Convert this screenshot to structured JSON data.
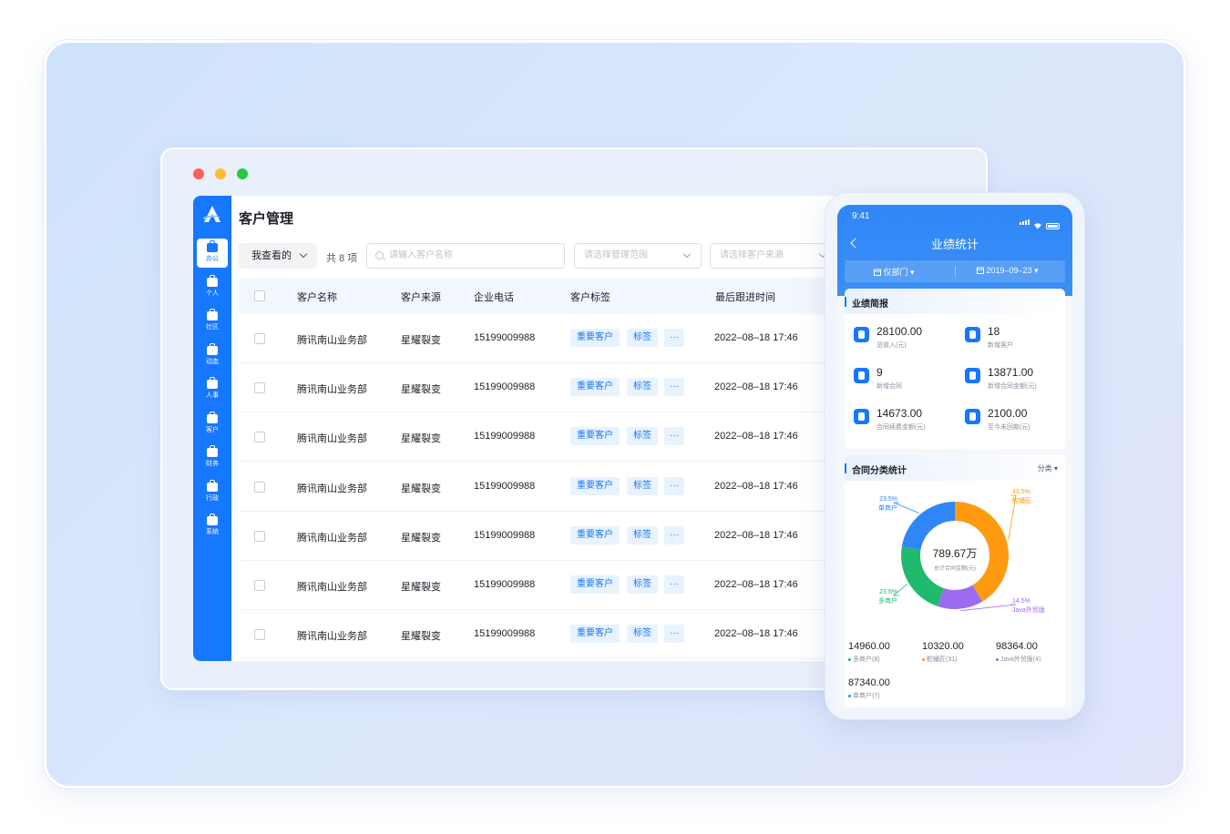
{
  "desktop": {
    "window_dots": [
      "#ff5f57",
      "#febc2e",
      "#28c840"
    ],
    "page_title": "客户管理",
    "sidebar": {
      "logo": "app-logo",
      "items": [
        {
          "label": "办公",
          "icon": "briefcase-icon",
          "active": true
        },
        {
          "label": "个人",
          "icon": "briefcase-icon"
        },
        {
          "label": "社区",
          "icon": "briefcase-icon"
        },
        {
          "label": "动态",
          "icon": "briefcase-icon"
        },
        {
          "label": "人事",
          "icon": "briefcase-icon"
        },
        {
          "label": "客户",
          "icon": "briefcase-icon"
        },
        {
          "label": "财务",
          "icon": "briefcase-icon"
        },
        {
          "label": "行政",
          "icon": "briefcase-icon"
        },
        {
          "label": "系统",
          "icon": "briefcase-icon"
        }
      ]
    },
    "toolbar": {
      "view_filter": "我查看的",
      "count": "共 8 项",
      "search_placeholder": "请输入客户名称",
      "scope_placeholder": "请选择管理范围",
      "source_placeholder": "请选择客户来源"
    },
    "table": {
      "columns": [
        "客户名称",
        "客户来源",
        "企业电话",
        "客户标签",
        "最后跟进时间"
      ],
      "rows": [
        {
          "name": "腾讯南山业务部",
          "source": "星耀裂变",
          "phone": "15199009988",
          "tags": [
            "重要客户",
            "标签",
            "···"
          ],
          "last": "2022–08–18 17:46"
        },
        {
          "name": "腾讯南山业务部",
          "source": "星耀裂变",
          "phone": "15199009988",
          "tags": [
            "重要客户",
            "标签",
            "···"
          ],
          "last": "2022–08–18 17:46"
        },
        {
          "name": "腾讯南山业务部",
          "source": "星耀裂变",
          "phone": "15199009988",
          "tags": [
            "重要客户",
            "标签",
            "···"
          ],
          "last": "2022–08–18 17:46"
        },
        {
          "name": "腾讯南山业务部",
          "source": "星耀裂变",
          "phone": "15199009988",
          "tags": [
            "重要客户",
            "标签",
            "···"
          ],
          "last": "2022–08–18 17:46"
        },
        {
          "name": "腾讯南山业务部",
          "source": "星耀裂变",
          "phone": "15199009988",
          "tags": [
            "重要客户",
            "标签",
            "···"
          ],
          "last": "2022–08–18 17:46"
        },
        {
          "name": "腾讯南山业务部",
          "source": "星耀裂变",
          "phone": "15199009988",
          "tags": [
            "重要客户",
            "标签",
            "···"
          ],
          "last": "2022–08–18 17:46"
        },
        {
          "name": "腾讯南山业务部",
          "source": "星耀裂变",
          "phone": "15199009988",
          "tags": [
            "重要客户",
            "标签",
            "···"
          ],
          "last": "2022–08–18 17:46"
        }
      ]
    }
  },
  "mobile": {
    "time": "9:41",
    "title": "业绩统计",
    "filters": {
      "dept": "仅部门",
      "date": "2019–09–23"
    },
    "report": {
      "title": "业绩简报",
      "kpis": [
        {
          "value": "28100.00",
          "label": "总收入(元)",
          "icon": "money-bag-icon"
        },
        {
          "value": "18",
          "label": "新增客户",
          "icon": "user-icon"
        },
        {
          "value": "9",
          "label": "新增合同",
          "icon": "contract-icon"
        },
        {
          "value": "13871.00",
          "label": "新增合同金额(元)",
          "icon": "yen-icon"
        },
        {
          "value": "14673.00",
          "label": "合同续费金额(元)",
          "icon": "coins-icon"
        },
        {
          "value": "2100.00",
          "label": "至今未回款(元)",
          "icon": "coins-icon"
        }
      ]
    },
    "contract_stats": {
      "title": "合同分类统计",
      "classify": "分类",
      "center_value": "789.67万",
      "center_label": "总计合同金额(元)",
      "summary": [
        {
          "value": "14960.00",
          "label": "多商户(8)",
          "color": "#1fba6e"
        },
        {
          "value": "10320.00",
          "label": "舵蛹匠(31)",
          "color": "#ff9a10"
        },
        {
          "value": "98364.00",
          "label": "Java外贸版(4)",
          "color": "#9b6bf2"
        },
        {
          "value": "87340.00",
          "label": "单商户(7)",
          "color": "#2f86f6"
        }
      ]
    }
  },
  "chart_data": {
    "type": "pie",
    "categories": [
      "舵蛹匠",
      "Java外贸版",
      "多商户",
      "单商户"
    ],
    "values": [
      43.5,
      14.5,
      23.5,
      23.5
    ],
    "percent_labels": [
      "43.5%",
      "14.5%",
      "23.5%",
      "23.5%"
    ],
    "colors": [
      "#ff9a10",
      "#9b6bf2",
      "#1fba6e",
      "#2f86f6"
    ]
  }
}
